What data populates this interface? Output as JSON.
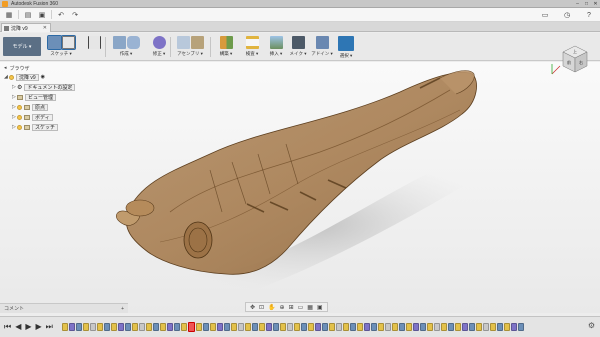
{
  "app": {
    "title": "Autodesk Fusion 360"
  },
  "window_controls": [
    "–",
    "□",
    "✕"
  ],
  "doc_tab": {
    "label": "沈降 v9",
    "close": "✕"
  },
  "ribbon": {
    "workspace": "モデル ▾",
    "tools": [
      {
        "label": "スケッチ ▾",
        "color": "#6c8fb8"
      },
      {
        "label": "作成 ▾",
        "color": "#8aa6c7"
      },
      {
        "label": "修正 ▾",
        "color": "#7e9ec2"
      },
      {
        "label": "アセンブリ ▾",
        "color": "#b7a27a"
      },
      {
        "label": "構築 ▾",
        "color": "#d79a3c"
      },
      {
        "label": "検査 ▾",
        "color": "#e0b440"
      },
      {
        "label": "挿入 ▾",
        "color": "#7d9bc3"
      },
      {
        "label": "メイク ▾",
        "color": "#4d5a68"
      },
      {
        "label": "アドイン ▾",
        "color": "#6a88b1"
      },
      {
        "label": "選択 ▾",
        "color": "#2e76b4"
      }
    ]
  },
  "browser": {
    "header": "ブラウザ",
    "root": "沈降 v9",
    "items": [
      {
        "label": "ドキュメントの設定",
        "icon": "gear-icon"
      },
      {
        "label": "ビュー管理",
        "icon": "folder-icon"
      },
      {
        "label": "原点",
        "icon": "folder-icon"
      },
      {
        "label": "ボディ",
        "icon": "folder-icon"
      },
      {
        "label": "スケッチ",
        "icon": "folder-icon"
      }
    ]
  },
  "comments": {
    "label": "コメント",
    "plus": "+"
  },
  "viewcube": {
    "face_top": "上",
    "face_front": "前",
    "face_right": "右"
  },
  "colors": {
    "model": "#a0774a",
    "accent": "#2d6aa5"
  }
}
